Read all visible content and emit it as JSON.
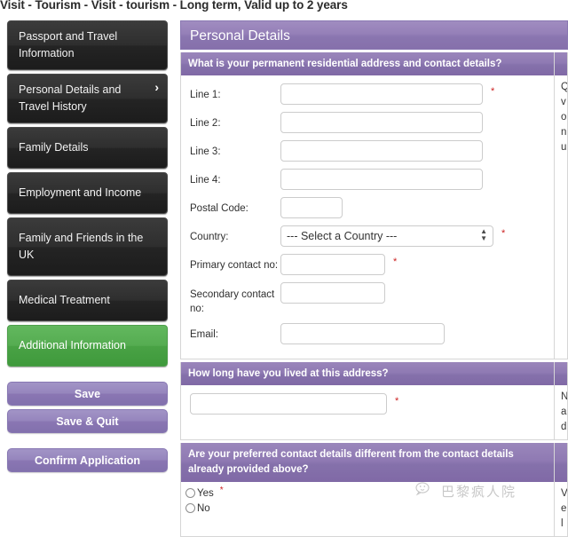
{
  "page_title": "Visit - Tourism - Visit - tourism - Long term, Valid up to 2 years",
  "colors": {
    "accent_purple": "#8f7ab3",
    "header_purple": "#9580b8",
    "active_green": "#55ac51",
    "sidebar_dark": "#2e2e2e",
    "required_red": "#cc2222"
  },
  "sidebar": {
    "items": [
      {
        "label": "Passport and Travel Information",
        "state": "default",
        "chevron": ""
      },
      {
        "label": "Personal Details and Travel History",
        "state": "default",
        "chevron": "›"
      },
      {
        "label": "Family Details",
        "state": "default",
        "chevron": ""
      },
      {
        "label": "Employment and Income",
        "state": "default",
        "chevron": ""
      },
      {
        "label": "Family and Friends in the UK",
        "state": "default",
        "chevron": ""
      },
      {
        "label": "Medical Treatment",
        "state": "default",
        "chevron": ""
      },
      {
        "label": "Additional Information",
        "state": "active",
        "chevron": ""
      }
    ],
    "buttons": [
      {
        "label": "Save"
      },
      {
        "label": "Save & Quit"
      },
      {
        "label": "Confirm Application"
      }
    ]
  },
  "main": {
    "header_title": "Personal Details",
    "sections": [
      {
        "question": "What is your permanent residential address and contact details?",
        "aside_text": "Q vo nu",
        "fields": [
          {
            "label": "Line 1:",
            "value": "",
            "required": true,
            "type": "text",
            "size": "wide"
          },
          {
            "label": "Line 2:",
            "value": "",
            "required": false,
            "type": "text",
            "size": "wide"
          },
          {
            "label": "Line 3:",
            "value": "",
            "required": false,
            "type": "text",
            "size": "wide"
          },
          {
            "label": "Line 4:",
            "value": "",
            "required": false,
            "type": "text",
            "size": "wide"
          },
          {
            "label": "Postal Code:",
            "value": "",
            "required": false,
            "type": "text",
            "size": "small"
          },
          {
            "label": "Country:",
            "value": "--- Select a Country ---",
            "required": true,
            "type": "select",
            "size": "select"
          },
          {
            "label": "Primary contact no:",
            "value": "",
            "required": true,
            "type": "text",
            "size": "mid"
          },
          {
            "label": "Secondary contact no:",
            "value": "",
            "required": false,
            "type": "text",
            "size": "mid"
          },
          {
            "label": "Email:",
            "value": "",
            "required": false,
            "type": "text",
            "size": "email"
          }
        ]
      },
      {
        "question": "How long have you lived at this address?",
        "aside_text": "N ad",
        "duration_value": "",
        "duration_required": true
      },
      {
        "question": "Are your preferred contact details different from the contact details already provided above?",
        "aside_text": "V el",
        "options": [
          {
            "label": "Yes",
            "selected": false,
            "required": true
          },
          {
            "label": "No",
            "selected": false,
            "required": false
          }
        ]
      }
    ]
  },
  "watermark": {
    "text": "巴黎疯人院",
    "icon": "wechat-icon"
  },
  "symbols": {
    "required_mark": "*",
    "select_up": "▲",
    "select_down": "▼"
  }
}
